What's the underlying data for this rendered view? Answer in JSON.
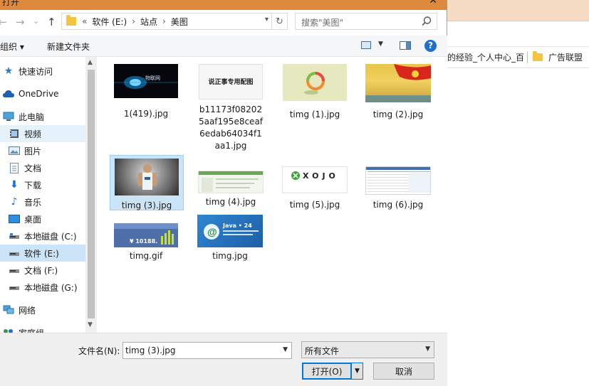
{
  "dialog": {
    "title": "打开",
    "close_glyph": "✕",
    "nav": {
      "back": "←",
      "forward": "→",
      "dropdown": "⌄",
      "up": "↑"
    },
    "breadcrumb": {
      "overflow": "«",
      "items": [
        "软件 (E:)",
        "站点",
        "美图"
      ],
      "sep": "›"
    },
    "refresh_glyph": "↻",
    "search_placeholder": "搜索\"美图\"",
    "toolbar": {
      "organize": "组织 ▾",
      "new_folder": "新建文件夹",
      "help": "?"
    },
    "sidebar": {
      "items": [
        {
          "label": "快速访问",
          "icon": "star-icon"
        },
        {
          "label": "OneDrive",
          "icon": "cloud-icon"
        },
        {
          "label": "此电脑",
          "icon": "computer-icon"
        },
        {
          "label": "视频",
          "icon": "video-icon"
        },
        {
          "label": "图片",
          "icon": "picture-icon"
        },
        {
          "label": "文档",
          "icon": "document-icon"
        },
        {
          "label": "下载",
          "icon": "download-icon"
        },
        {
          "label": "音乐",
          "icon": "music-icon"
        },
        {
          "label": "桌面",
          "icon": "desktop-icon"
        },
        {
          "label": "本地磁盘 (C:)",
          "icon": "drive-icon"
        },
        {
          "label": "软件 (E:)",
          "icon": "drive-icon"
        },
        {
          "label": "文档 (F:)",
          "icon": "drive-icon"
        },
        {
          "label": "本地磁盘 (G:)",
          "icon": "drive-icon"
        },
        {
          "label": "网络",
          "icon": "network-icon"
        },
        {
          "label": "家庭组",
          "icon": "homegroup-icon"
        }
      ]
    },
    "files": [
      {
        "name": "1(419).jpg",
        "thumb_text": "物联网"
      },
      {
        "name": "b11173f082025aaf195e8ceaf6edab64034f1aa1.jpg",
        "thumb_text": "说正事专用配图"
      },
      {
        "name": "timg (1).jpg"
      },
      {
        "name": "timg (2).jpg"
      },
      {
        "name": "timg (3).jpg"
      },
      {
        "name": "timg (4).jpg"
      },
      {
        "name": "timg (5).jpg",
        "thumb_text": "XOJO"
      },
      {
        "name": "timg (6).jpg"
      },
      {
        "name": "timg.gif",
        "thumb_text": "¥ 10188."
      },
      {
        "name": "timg.jpg",
        "thumb_text": "Java • 24"
      }
    ],
    "bottom": {
      "filename_label": "文件名(N):",
      "filename_value": "timg (3).jpg",
      "filetype_value": "所有文件",
      "open_button": "打开(O)",
      "cancel_button": "取消"
    }
  },
  "background": {
    "bookmarks": [
      "的经验_个人中心_百",
      "广告联盟"
    ]
  },
  "colors": {
    "title_bar": "#dd8a3f",
    "selection": "#cce4f7",
    "accent": "#0078d7"
  }
}
